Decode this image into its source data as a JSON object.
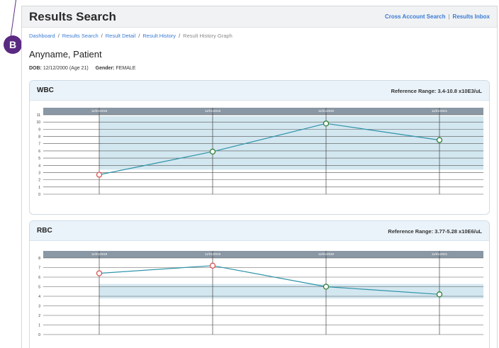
{
  "header": {
    "title": "Results Search",
    "links": [
      "Cross Account Search",
      "Results Inbox"
    ]
  },
  "breadcrumb": {
    "items": [
      "Dashboard",
      "Results Search",
      "Result Detail",
      "Result History"
    ],
    "current": "Result History Graph"
  },
  "callout": {
    "label": "B"
  },
  "patient": {
    "name": "Anyname, Patient",
    "dob_label": "DOB:",
    "dob_value": "12/12/2000 (Age 21)",
    "gender_label": "Gender:",
    "gender_value": "FEMALE"
  },
  "colors": {
    "accent": "#3a7bd5",
    "band": "#d3e7f0",
    "line": "#2e93a8",
    "normal_point": "#2e7d32",
    "abnormal_point": "#d9534f",
    "callout": "#5a2a82"
  },
  "chart_data": [
    {
      "type": "line",
      "title": "WBC",
      "reference_label": "Reference Range: 3.4-10.8 x10E3/uL",
      "reference_range": [
        3.4,
        10.8
      ],
      "x": [
        "11/01/2018",
        "11/01/2019",
        "11/01/2020",
        "11/01/2021"
      ],
      "values": [
        2.7,
        5.9,
        9.8,
        7.5
      ],
      "abnormal": [
        true,
        false,
        false,
        false
      ],
      "ylim": [
        0,
        11
      ],
      "yticks": [
        0,
        1,
        2,
        3,
        4,
        5,
        6,
        7,
        8,
        9,
        10,
        11
      ],
      "grid": true
    },
    {
      "type": "line",
      "title": "RBC",
      "reference_label": "Reference Range: 3.77-5.28 x10E6/uL",
      "reference_range": [
        3.77,
        5.28
      ],
      "x": [
        "11/01/2018",
        "11/01/2019",
        "11/01/2020",
        "11/01/2021"
      ],
      "values": [
        6.4,
        7.2,
        5.0,
        4.2
      ],
      "abnormal": [
        true,
        true,
        false,
        false
      ],
      "ylim": [
        0,
        8
      ],
      "yticks": [
        0,
        1,
        2,
        3,
        4,
        5,
        6,
        7,
        8
      ],
      "grid": true
    }
  ]
}
